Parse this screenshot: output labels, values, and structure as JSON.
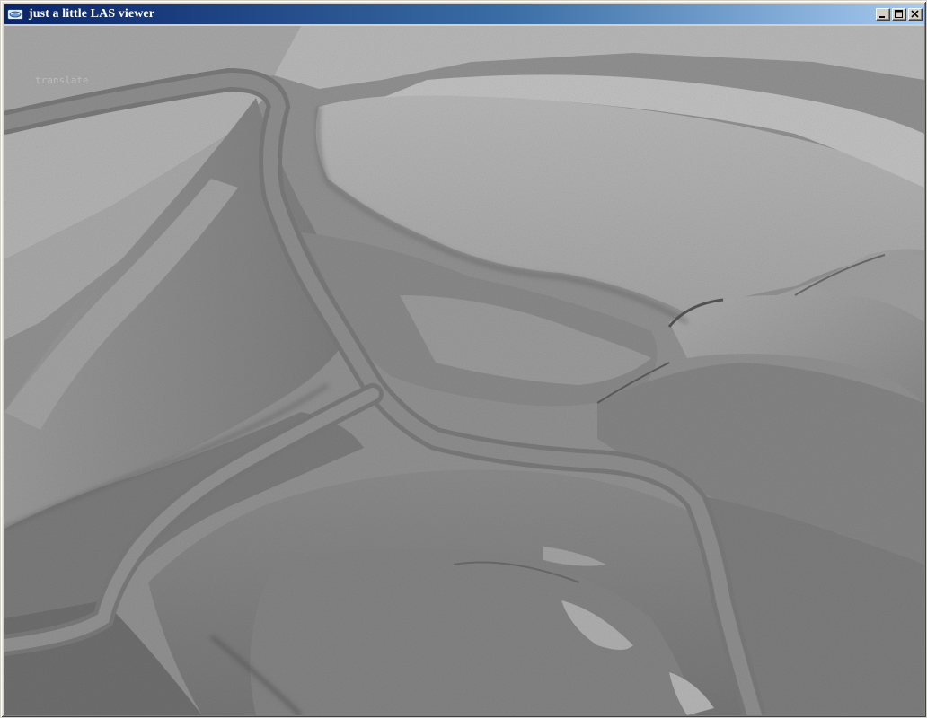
{
  "window": {
    "title": "just a little LAS viewer",
    "icon": "app-icon"
  },
  "controls": {
    "minimize_icon": "minimize-icon",
    "maximize_icon": "maximize-icon",
    "close_icon": "close-icon"
  },
  "viewport": {
    "overlay_label": "translate",
    "colors": {
      "terrain_base": "#8e8e8e",
      "terrain_light": "#c8c8c8",
      "terrain_dark": "#5a5a5a",
      "titlebar_start": "#0a246a",
      "titlebar_end": "#a6caf0"
    }
  }
}
